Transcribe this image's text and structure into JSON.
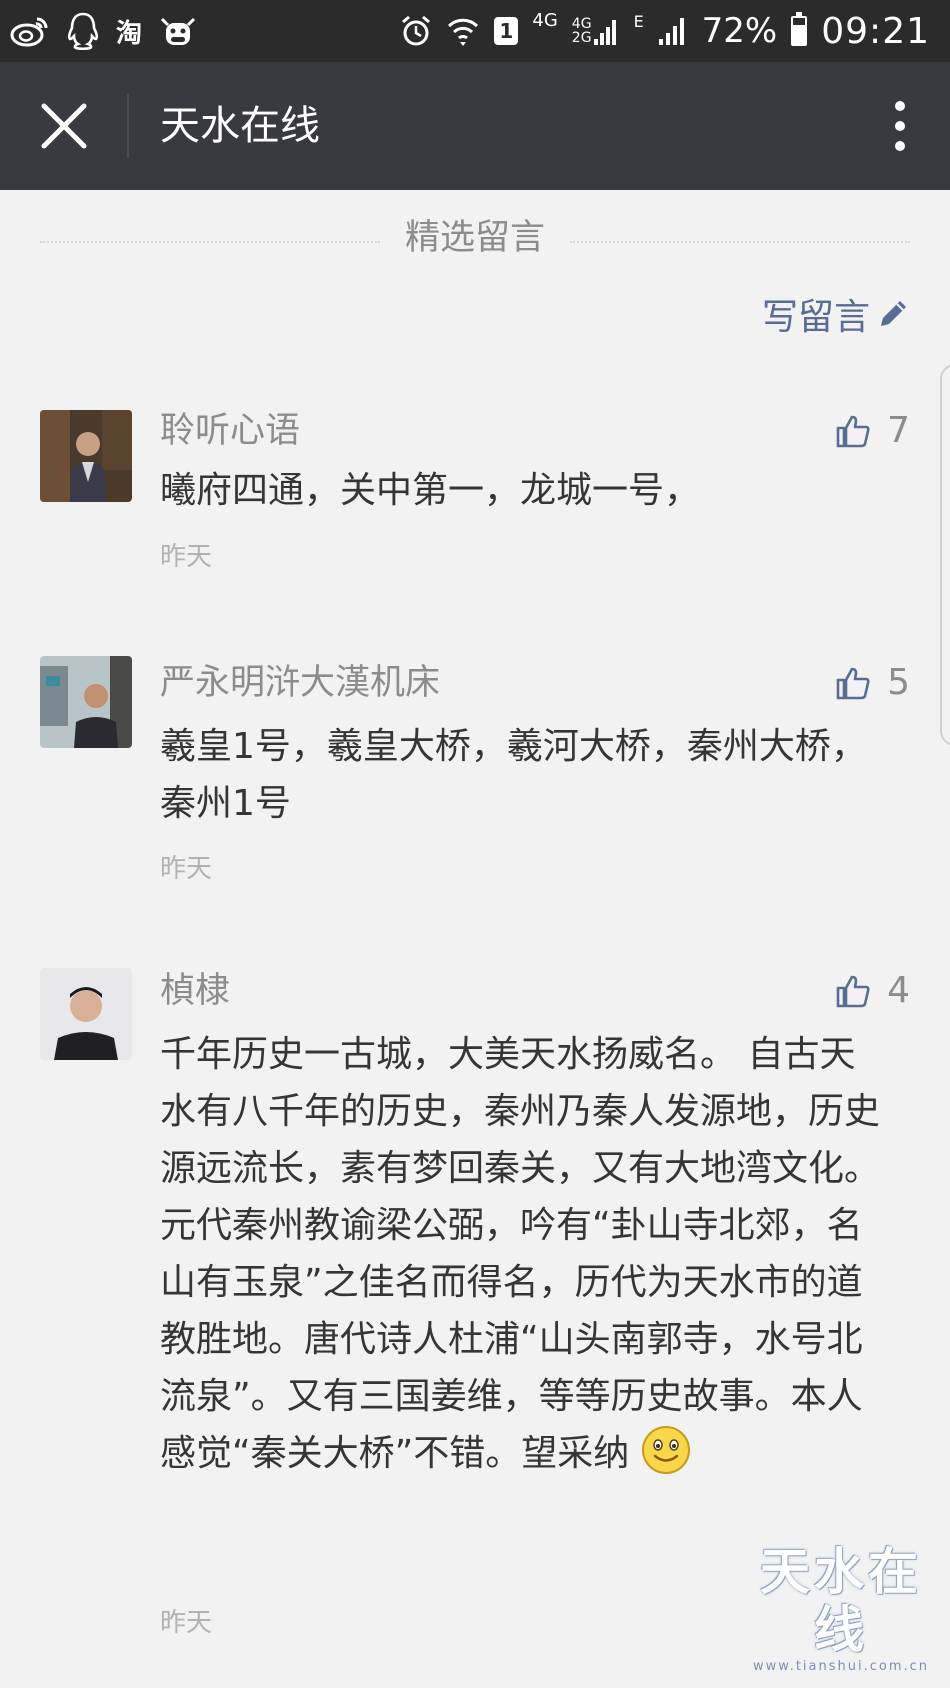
{
  "status_bar": {
    "left_icons": [
      "weibo-icon",
      "qq-icon",
      "taobao-icon",
      "cow-app-icon"
    ],
    "taobao_label": "淘",
    "sim1_badge": "1",
    "net_4g": "4G",
    "net_4g_stack": "4G",
    "net_2g_stack": "2G",
    "net_e": "E",
    "battery_percent": "72%",
    "battery_level": 0.72,
    "time": "09:21"
  },
  "header": {
    "title": "天水在线"
  },
  "section": {
    "title": "精选留言",
    "write_label": "写留言"
  },
  "comments": [
    {
      "nickname": "聆听心语",
      "text": "曦府四通，关中第一，龙城一号，",
      "time": "昨天",
      "likes": "7"
    },
    {
      "nickname": "严永明浒大漢机床",
      "text": "羲皇1号，羲皇大桥，羲河大桥，秦州大桥，秦州1号",
      "time": "昨天",
      "likes": "5"
    },
    {
      "nickname": "楨棣",
      "text": "千年历史一古城，大美天水扬威名。 自古天水有八千年的历史，秦州乃秦人发源地，历史源远流长，素有梦回秦关，又有大地湾文化。元代秦州教谕梁公弼，吟有“卦山寺北郊，名山有玉泉”之佳名而得名，历代为天水市的道教胜地。唐代诗人杜浦“山头南郭寺，水号北流泉”。又有三国姜维，等等历史故事。本人感觉“秦关大桥”不错。望采纳",
      "time": "昨天",
      "likes": "4"
    }
  ],
  "watermark": {
    "main": "天水在线",
    "sub": "www.tianshui.com.cn"
  },
  "colors": {
    "status_bar_bg": "#2b2b2b",
    "title_bar_bg": "#393a3f",
    "page_bg": "#f2f2f2",
    "link": "#586c94",
    "muted": "#8c8c8c",
    "body_text": "#353535"
  }
}
